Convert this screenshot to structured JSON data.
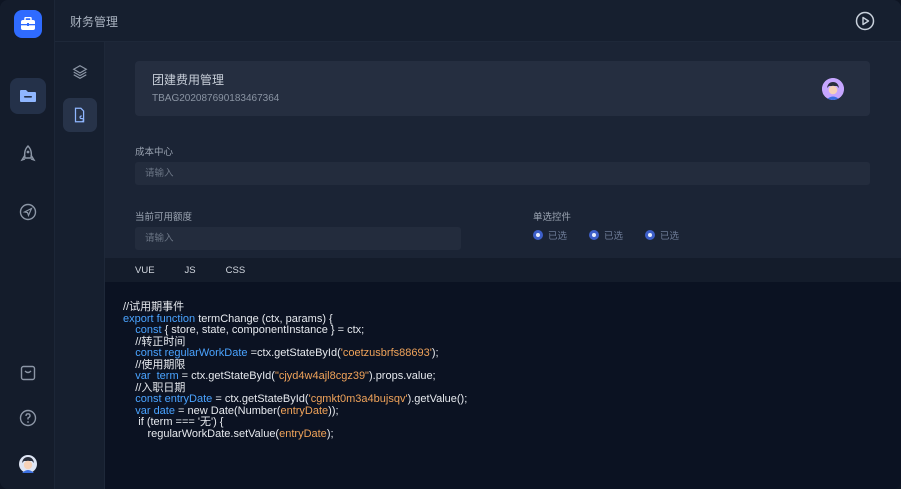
{
  "header": {
    "title": "财务管理"
  },
  "card": {
    "name": "团建费用管理",
    "code": "TBAG202087690183467364"
  },
  "form": {
    "cost_center": {
      "label": "成本中心",
      "placeholder": "请输入"
    },
    "available": {
      "label": "当前可用额度",
      "placeholder": "请输入"
    },
    "radio": {
      "label": "单选控件",
      "options": [
        "已选",
        "已选",
        "已选"
      ]
    }
  },
  "tabs": [
    "VUE",
    "JS",
    "CSS"
  ],
  "code": {
    "l1": "//试用期事件",
    "l2a": "export function ",
    "l2b": "termChange (ctx, params) {",
    "l3a": "    const ",
    "l3b": "{ store, state, componentInstance } = ctx;",
    "l4": "    //转正时间",
    "l5a": "    const ",
    "l5b": "regularWorkDate",
    "l5c": " =ctx.getStateById(",
    "l5d": "'coetzusbrfs88693'",
    "l5e": ");",
    "l6": "    //使用期限",
    "l7a": "    var ",
    "l7b": " term",
    "l7c": " = ctx.getStateById(",
    "l7d": "\"cjyd4w4ajl8cgz39\"",
    "l7e": ").props.value;",
    "l8": "    //入职日期",
    "l9a": "    const ",
    "l9b": "entryDate",
    "l9c": " = ctx.getStateById(",
    "l9d": "'cgmkt0m3a4bujsqv'",
    "l9e": ").getValue();",
    "l10a": "    var ",
    "l10b": "date",
    "l10c": " = new Date(Number(",
    "l10d": "entryDate",
    "l10e": "));",
    "l11": "     if (term === '无') {",
    "l12a": "        regularWorkDate.setValue(",
    "l12b": "entryDate",
    "l12c": ");"
  }
}
